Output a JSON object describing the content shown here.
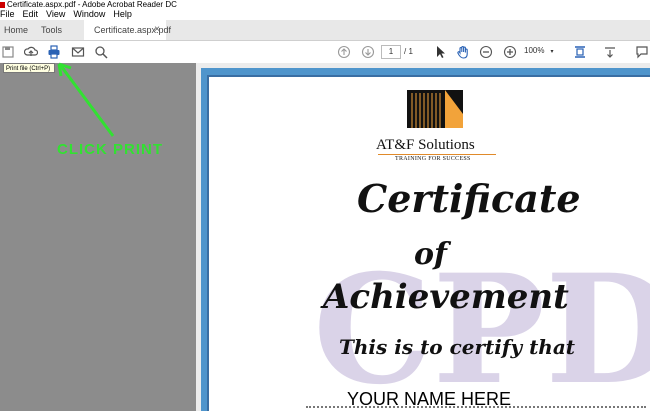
{
  "window": {
    "title": "Certificate.aspx.pdf - Adobe Acrobat Reader DC"
  },
  "menu": {
    "items": [
      "File",
      "Edit",
      "View",
      "Window",
      "Help"
    ]
  },
  "tabs": {
    "home": "Home",
    "tools": "Tools",
    "document": "Certificate.aspx.pdf",
    "close": "×"
  },
  "toolbar": {
    "page_current": "1",
    "page_total": "/ 1",
    "zoom": "100%"
  },
  "tooltip": {
    "text": "Print file (Ctrl+P)"
  },
  "annotation": {
    "text": "CLICK PRINT"
  },
  "certificate": {
    "company": "AT&F Solutions",
    "tagline": "TRAINING FOR SUCCESS",
    "title1": "Certificate",
    "title2": "of",
    "title3": "Achievement",
    "certify": "This is to certify that",
    "watermark": "CPD",
    "name": "YOUR NAME HERE"
  },
  "colors": {
    "annotation": "#32e132",
    "border": "#4f95cc",
    "brand_accent": "#e08a2a",
    "watermark": "#d7cfe6"
  }
}
